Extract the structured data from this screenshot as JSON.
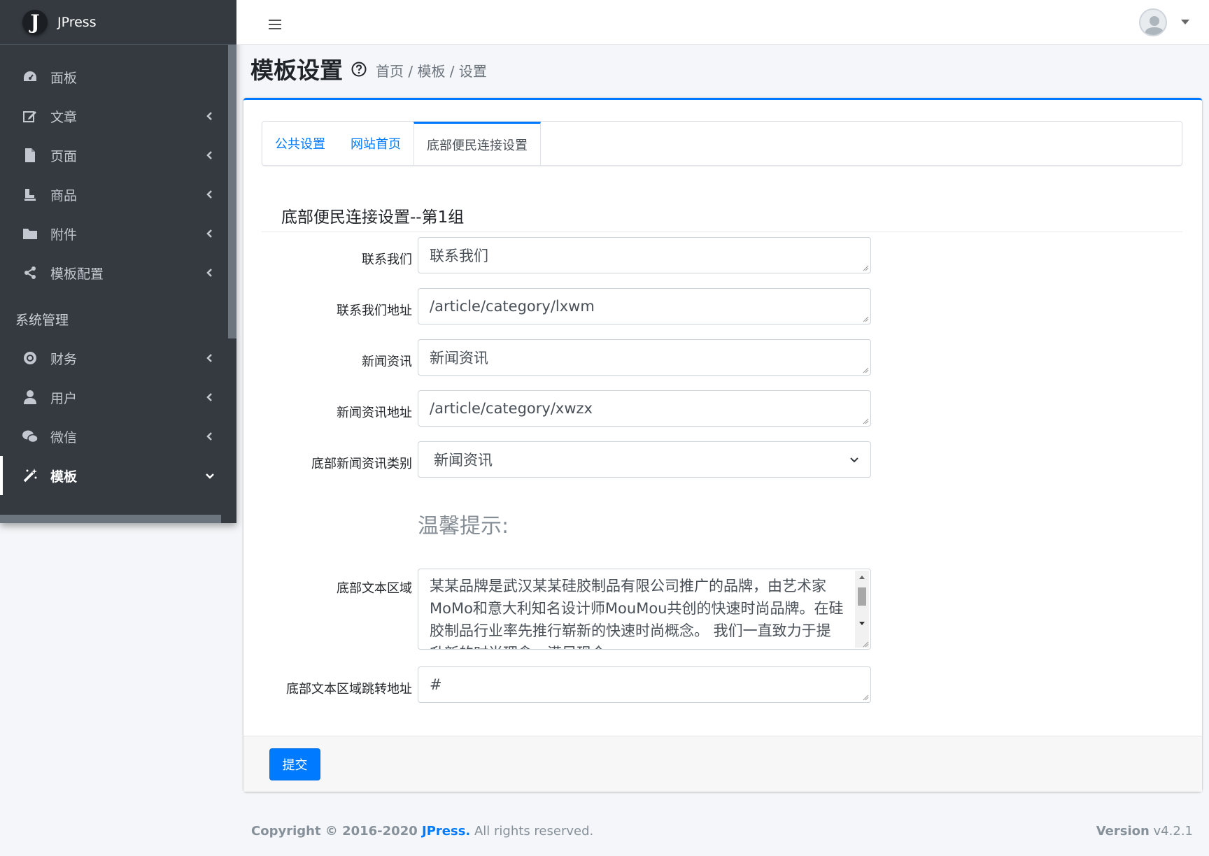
{
  "brand": {
    "logo_letter": "J",
    "name": "JPress"
  },
  "sidebar": {
    "items": [
      {
        "label": "面板",
        "icon": "dashboard-icon"
      },
      {
        "label": "文章",
        "icon": "edit-icon"
      },
      {
        "label": "页面",
        "icon": "file-icon"
      },
      {
        "label": "商品",
        "icon": "product-icon"
      },
      {
        "label": "附件",
        "icon": "folder-icon"
      },
      {
        "label": "模板配置",
        "icon": "share-icon"
      }
    ],
    "section_header": "系统管理",
    "system_items": [
      {
        "label": "财务",
        "icon": "finance-icon"
      },
      {
        "label": "用户",
        "icon": "user-icon"
      },
      {
        "label": "微信",
        "icon": "wechat-icon"
      },
      {
        "label": "模板",
        "icon": "magic-icon"
      }
    ]
  },
  "header": {
    "title": "模板设置",
    "breadcrumb": [
      "首页",
      "模板",
      "设置"
    ],
    "separator": " / "
  },
  "tabs": [
    {
      "label": "公共设置"
    },
    {
      "label": "网站首页"
    },
    {
      "label": "底部便民连接设置"
    }
  ],
  "form": {
    "section_title": "底部便民连接设置--第1组",
    "fields": [
      {
        "label": "联系我们",
        "value": "联系我们"
      },
      {
        "label": "联系我们地址",
        "value": "/article/category/lxwm"
      },
      {
        "label": "新闻资讯",
        "value": "新闻资讯"
      },
      {
        "label": "新闻资讯地址",
        "value": "/article/category/xwzx"
      }
    ],
    "select": {
      "label": "底部新闻资讯类别",
      "value": "新闻资讯"
    },
    "tip": "温馨提示:",
    "textarea": {
      "label": "底部文本区域",
      "value": "某某品牌是武汉某某硅胶制品有限公司推广的品牌，由艺术家MoMo和意大利知名设计师MouMou共创的快速时尚品牌。在硅胶制品行业率先推行崭新的快速时尚概念。 我们一直致力于提升新的时尚理念，满足现今..."
    },
    "jump": {
      "label": "底部文本区域跳转地址",
      "value": "#"
    },
    "submit_label": "提交"
  },
  "footer": {
    "copyright": "Copyright © 2016-2020 ",
    "brand": "JPress.",
    "rights": " All rights reserved.",
    "version_label": "Version",
    "version": " v4.2.1"
  },
  "colors": {
    "primary": "#007bff",
    "sidebar": "#343a40"
  }
}
